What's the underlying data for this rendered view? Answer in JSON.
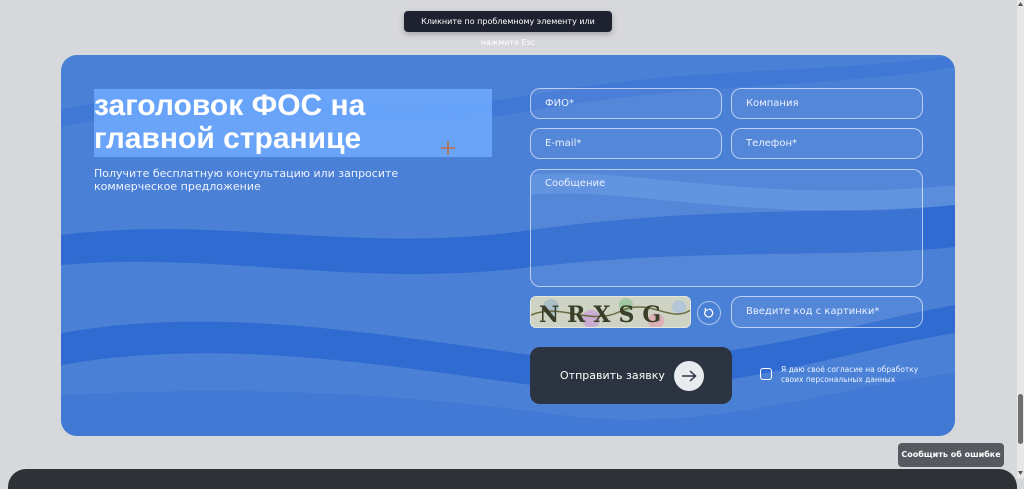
{
  "tooltip": {
    "text": "Кликните по проблемному элементу или нажмите Esc"
  },
  "hero": {
    "title_line1": "заголовок ФОС на",
    "title_line2": "главной странице",
    "subtitle": "Получите бесплатную консультацию или запросите коммерческое предложение"
  },
  "form": {
    "fio_placeholder": "ФИО*",
    "company_placeholder": "Компания",
    "email_placeholder": "E-mail*",
    "phone_placeholder": "Телефон*",
    "message_placeholder": "Сообщение",
    "captcha_placeholder": "Введите код с картинки*",
    "captcha_text": "NRXSG",
    "submit_label": "Отправить заявку",
    "consent_text": "Я даю своё согласие на обработку своих персональных данных"
  },
  "report_button": {
    "label": "Сообщить об ошибке"
  },
  "colors": {
    "card_bg": "#4a80d6",
    "wave": "#2f6bd0",
    "submit_bg": "#2b3440",
    "page_bg": "#d7d8db"
  }
}
